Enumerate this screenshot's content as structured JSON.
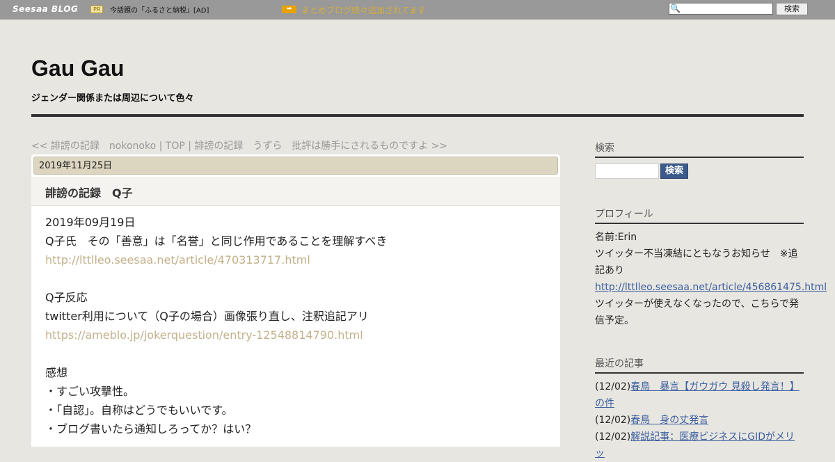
{
  "topbar": {
    "logo": "Seesaa BLOG",
    "pr_badge": "PR",
    "pr_text": "今話題の「ふるさと納税」[AD]",
    "arrow": "➡",
    "ticker": "まとめブログ続々追加されてます",
    "search_button": "検索",
    "search_icon": "🔍"
  },
  "header": {
    "title": "Gau Gau",
    "description": "ジェンダー関係または周辺について色々"
  },
  "pager": {
    "prev": "<< 誹謗の記録　nokonoko",
    "sep1": " | ",
    "top": "TOP",
    "sep2": " | ",
    "next": "誹謗の記録　うずら　批評は勝手にされるものですよ >>"
  },
  "article": {
    "date": "2019年11月25日",
    "title": "誹謗の記録　Q子",
    "lines": [
      "2019年09月19日",
      "Q子氏　その「善意」は「名誉」と同じ作用であることを理解すべき",
      "http://lttlleo.seesaa.net/article/470313717.html",
      "",
      "Q子反応",
      "twitter利用について（Q子の場合）画像張り直し、注釈追記アリ",
      "https://ameblo.jp/jokerquestion/entry-12548814790.html",
      "",
      "感想",
      "・すごい攻撃性。",
      "・「自認」。自称はどうでもいいです。",
      "・ブログ書いたら通知しろってか？はい？"
    ]
  },
  "sidebar": {
    "search_heading": "検索",
    "search_button": "検索",
    "profile_heading": "プロフィール",
    "profile_name": "名前:Erin",
    "profile_note_1": "ツイッター不当凍結にともなうお知らせ　※追",
    "profile_note_2": "記あり",
    "profile_link": "http://lttlleo.seesaa.net/article/456861475.html",
    "profile_after_1": "ツイッターが使えなくなったので、こちらで発",
    "profile_after_2": "信予定。",
    "recent_heading": "最近の記事",
    "recent": [
      {
        "date": "(12/02)",
        "title_1": "春鳥　暴言【ガウガウ 見殺し発言！】",
        "title_2": "の件"
      },
      {
        "date": "(12/02)",
        "title_1": "春鳥　身の丈発言",
        "title_2": ""
      },
      {
        "date": "(12/02)",
        "title_1": "解説記事：医療ビジネスにGIDがメリッ",
        "title_2": ""
      }
    ]
  }
}
